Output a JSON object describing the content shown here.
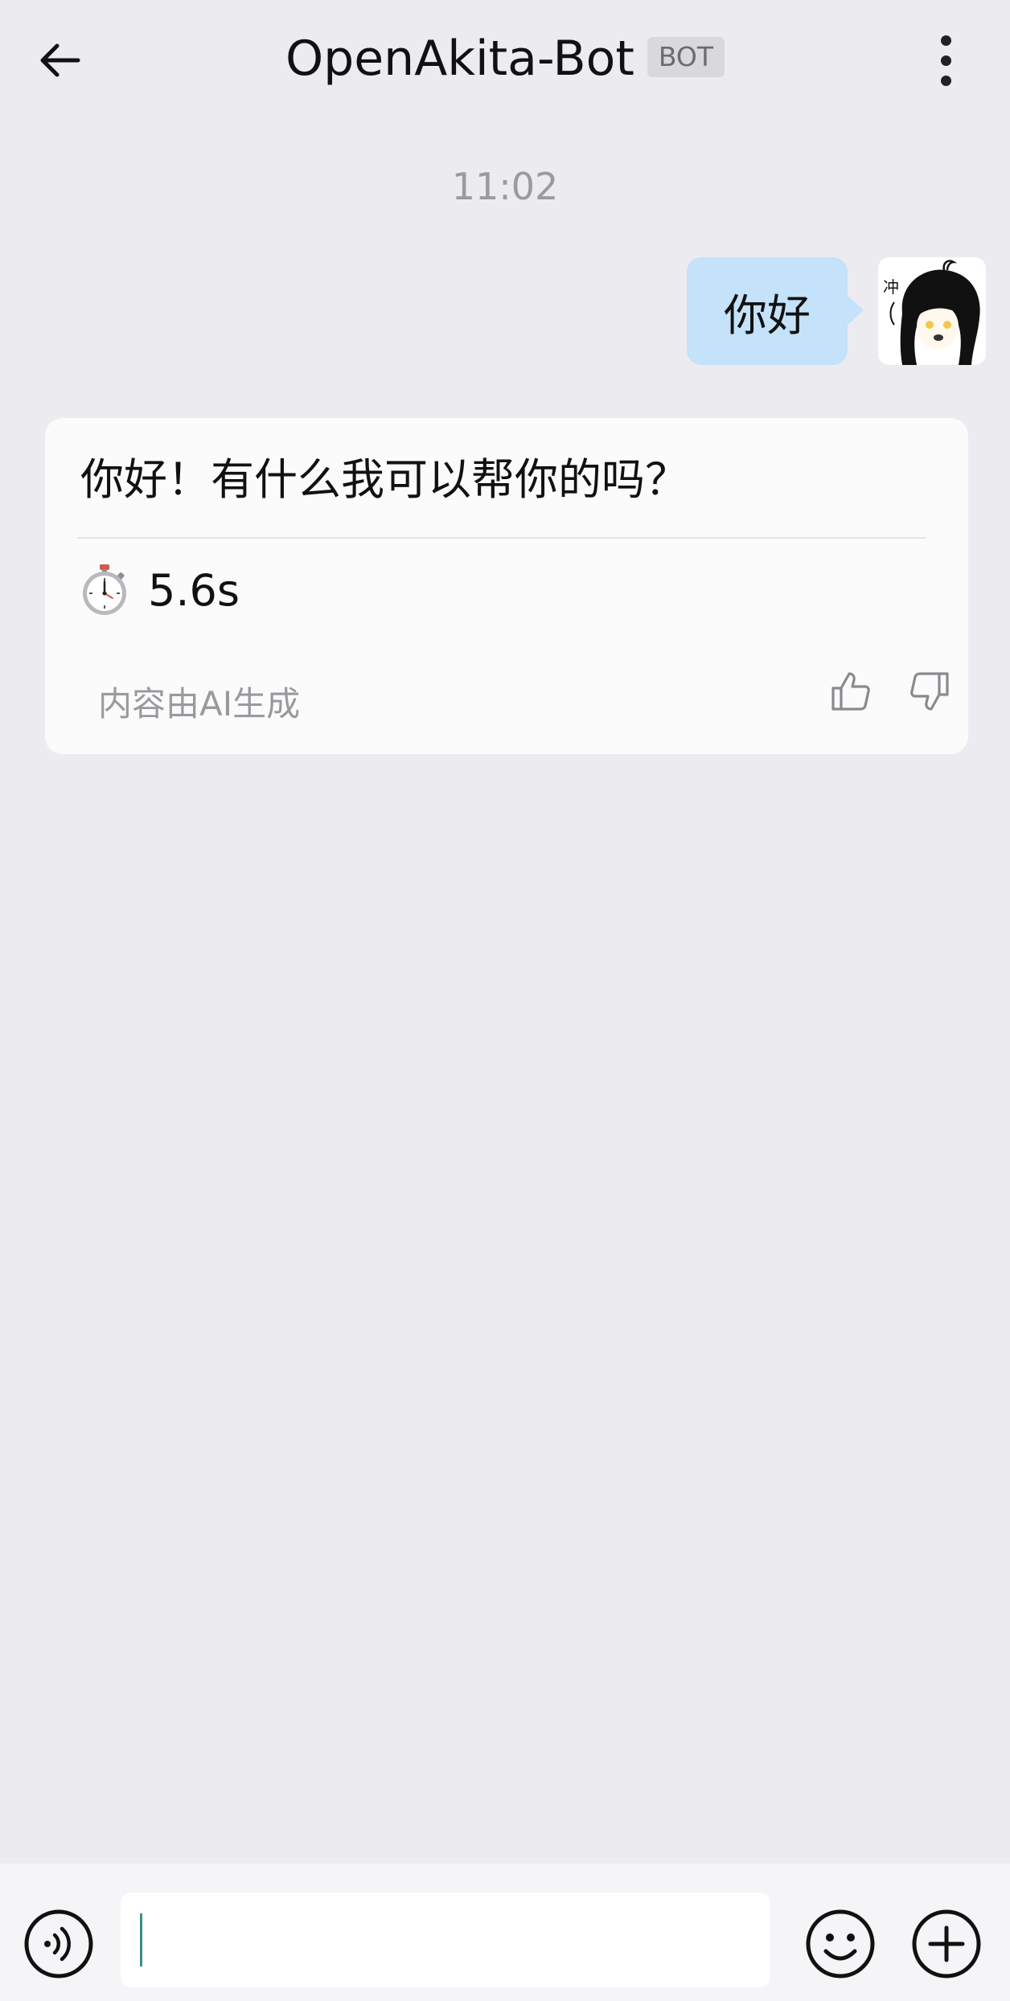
{
  "header": {
    "title": "OpenAkita-Bot",
    "badge": "BOT",
    "back_icon": "arrow-left-icon",
    "more_icon": "more-vertical-icon"
  },
  "chat": {
    "timestamp": "11:02",
    "outgoing_message": "你好",
    "incoming": {
      "text": "你好！有什么我可以帮你的吗？",
      "timer_icon": "stopwatch-icon",
      "timer_value": "5.6s",
      "ai_note": "内容由AI生成",
      "like_icon": "thumbs-up-icon",
      "dislike_icon": "thumbs-down-icon"
    }
  },
  "input_bar": {
    "value": "",
    "voice_icon": "voice-icon",
    "emoji_icon": "smiley-icon",
    "add_icon": "plus-circle-icon"
  },
  "colors": {
    "background": "#ECEBF0",
    "outgoing_bubble": "#C4E2F9",
    "incoming_card": "#FCFBFC",
    "muted_text": "#9A9A9E"
  }
}
